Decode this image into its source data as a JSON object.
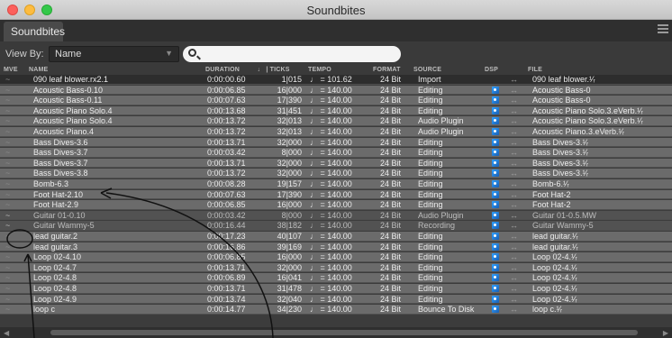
{
  "window": {
    "title": "Soundbites"
  },
  "tabs": [
    {
      "label": "Soundbites"
    }
  ],
  "viewbar": {
    "label": "View By:",
    "selected": "Name",
    "search_placeholder": ""
  },
  "columns": {
    "mve": "MVE",
    "name": "NAME",
    "duration": "DURATION",
    "ticks": "♩ | TICKS",
    "tempo": "TEMPO",
    "format": "FORMAT",
    "source": "SOURCE",
    "dsp": "DSP",
    "file": "FILE"
  },
  "rows": [
    {
      "name": "090 leaf blower.rx2.1",
      "duration": "0:00:00.60",
      "ticks": "1|015",
      "tempo": "♩ = 101.62",
      "format": "24 Bit",
      "source": "Import",
      "file": "090 leaf blower.¹⁄ᵣ",
      "dsp": false,
      "state": "sel"
    },
    {
      "name": "Acoustic Bass-0.10",
      "duration": "0:00:06.85",
      "ticks": "16|000",
      "tempo": "♩ = 140.00",
      "format": "24 Bit",
      "source": "Editing",
      "file": "Acoustic Bass-0",
      "dsp": true,
      "state": "norm"
    },
    {
      "name": "Acoustic Bass-0.11",
      "duration": "0:00:07.63",
      "ticks": "17|390",
      "tempo": "♩ = 140.00",
      "format": "24 Bit",
      "source": "Editing",
      "file": "Acoustic Bass-0",
      "dsp": true,
      "state": "norm"
    },
    {
      "name": "Acoustic Piano Solo.4",
      "duration": "0:00:13.68",
      "ticks": "31|451",
      "tempo": "♩ = 140.00",
      "format": "24 Bit",
      "source": "Editing",
      "file": "Acoustic Piano Solo.3.eVerb.¹⁄ᵣ",
      "dsp": true,
      "state": "norm"
    },
    {
      "name": "Acoustic Piano Solo.4",
      "duration": "0:00:13.72",
      "ticks": "32|013",
      "tempo": "♩ = 140.00",
      "format": "24 Bit",
      "source": "Audio Plugin",
      "file": "Acoustic Piano Solo.3.eVerb.¹⁄ᵣ",
      "dsp": true,
      "state": "norm"
    },
    {
      "name": "Acoustic Piano.4",
      "duration": "0:00:13.72",
      "ticks": "32|013",
      "tempo": "♩ = 140.00",
      "format": "24 Bit",
      "source": "Audio Plugin",
      "file": "Acoustic Piano.3.eVerb.¹⁄ᵣ",
      "dsp": true,
      "state": "norm"
    },
    {
      "name": "Bass Dives-3.6",
      "duration": "0:00:13.71",
      "ticks": "32|000",
      "tempo": "♩ = 140.00",
      "format": "24 Bit",
      "source": "Editing",
      "file": "Bass Dives-3.¹⁄ᵣ",
      "dsp": true,
      "state": "norm"
    },
    {
      "name": "Bass Dives-3.7",
      "duration": "0:00:03.42",
      "ticks": "8|000",
      "tempo": "♩ = 140.00",
      "format": "24 Bit",
      "source": "Editing",
      "file": "Bass Dives-3.¹⁄ᵣ",
      "dsp": true,
      "state": "norm"
    },
    {
      "name": "Bass Dives-3.7",
      "duration": "0:00:13.71",
      "ticks": "32|000",
      "tempo": "♩ = 140.00",
      "format": "24 Bit",
      "source": "Editing",
      "file": "Bass Dives-3.¹⁄ᵣ",
      "dsp": true,
      "state": "norm"
    },
    {
      "name": "Bass Dives-3.8",
      "duration": "0:00:13.72",
      "ticks": "32|000",
      "tempo": "♩ = 140.00",
      "format": "24 Bit",
      "source": "Editing",
      "file": "Bass Dives-3.¹⁄ᵣ",
      "dsp": true,
      "state": "norm"
    },
    {
      "name": "Bomb-6.3",
      "duration": "0:00:08.28",
      "ticks": "19|157",
      "tempo": "♩ = 140.00",
      "format": "24 Bit",
      "source": "Editing",
      "file": "Bomb-6.¹⁄ᵣ",
      "dsp": true,
      "state": "norm"
    },
    {
      "name": "Foot Hat-2.10",
      "duration": "0:00:07.63",
      "ticks": "17|390",
      "tempo": "♩ = 140.00",
      "format": "24 Bit",
      "source": "Editing",
      "file": "Foot Hat-2",
      "dsp": true,
      "state": "norm"
    },
    {
      "name": "Foot Hat-2.9",
      "duration": "0:00:06.85",
      "ticks": "16|000",
      "tempo": "♩ = 140.00",
      "format": "24 Bit",
      "source": "Editing",
      "file": "Foot Hat-2",
      "dsp": true,
      "state": "norm"
    },
    {
      "name": "Guitar 01-0.10",
      "duration": "0:00:03.42",
      "ticks": "8|000",
      "tempo": "♩ = 140.00",
      "format": "24 Bit",
      "source": "Audio Plugin",
      "file": "Guitar 01-0.5.MW",
      "dsp": true,
      "state": "dim"
    },
    {
      "name": "Guitar Wammy-5",
      "duration": "0:00:16.44",
      "ticks": "38|182",
      "tempo": "♩ = 140.00",
      "format": "24 Bit",
      "source": "Recording",
      "file": "Guitar Wammy-5",
      "dsp": true,
      "state": "dim"
    },
    {
      "name": "lead guitar.2",
      "duration": "0:00:17.23",
      "ticks": "40|107",
      "tempo": "♩ = 140.00",
      "format": "24 Bit",
      "source": "Editing",
      "file": "lead guitar.¹⁄ᵣ",
      "dsp": true,
      "state": "norm"
    },
    {
      "name": "lead guitar.3",
      "duration": "0:00:16.86",
      "ticks": "39|169",
      "tempo": "♩ = 140.00",
      "format": "24 Bit",
      "source": "Editing",
      "file": "lead guitar.¹⁄ᵣ",
      "dsp": true,
      "state": "norm"
    },
    {
      "name": "Loop 02-4.10",
      "duration": "0:00:06.85",
      "ticks": "16|000",
      "tempo": "♩ = 140.00",
      "format": "24 Bit",
      "source": "Editing",
      "file": "Loop 02-4.¹⁄ᵣ",
      "dsp": true,
      "state": "norm"
    },
    {
      "name": "Loop 02-4.7",
      "duration": "0:00:13.71",
      "ticks": "32|000",
      "tempo": "♩ = 140.00",
      "format": "24 Bit",
      "source": "Editing",
      "file": "Loop 02-4.¹⁄ᵣ",
      "dsp": true,
      "state": "norm"
    },
    {
      "name": "Loop 02-4.8",
      "duration": "0:00:06.89",
      "ticks": "16|041",
      "tempo": "♩ = 140.00",
      "format": "24 Bit",
      "source": "Editing",
      "file": "Loop 02-4.¹⁄ᵣ",
      "dsp": true,
      "state": "norm"
    },
    {
      "name": "Loop 02-4.8",
      "duration": "0:00:13.71",
      "ticks": "31|478",
      "tempo": "♩ = 140.00",
      "format": "24 Bit",
      "source": "Editing",
      "file": "Loop 02-4.¹⁄ᵣ",
      "dsp": true,
      "state": "norm"
    },
    {
      "name": "Loop 02-4.9",
      "duration": "0:00:13.74",
      "ticks": "32|040",
      "tempo": "♩ = 140.00",
      "format": "24 Bit",
      "source": "Editing",
      "file": "Loop 02-4.¹⁄ᵣ",
      "dsp": true,
      "state": "norm"
    },
    {
      "name": "loop c",
      "duration": "0:00:14.77",
      "ticks": "34|230",
      "tempo": "♩ = 140.00",
      "format": "24 Bit",
      "source": "Bounce To Disk",
      "file": "loop c.¹⁄ᵣ",
      "dsp": true,
      "state": "norm"
    }
  ]
}
